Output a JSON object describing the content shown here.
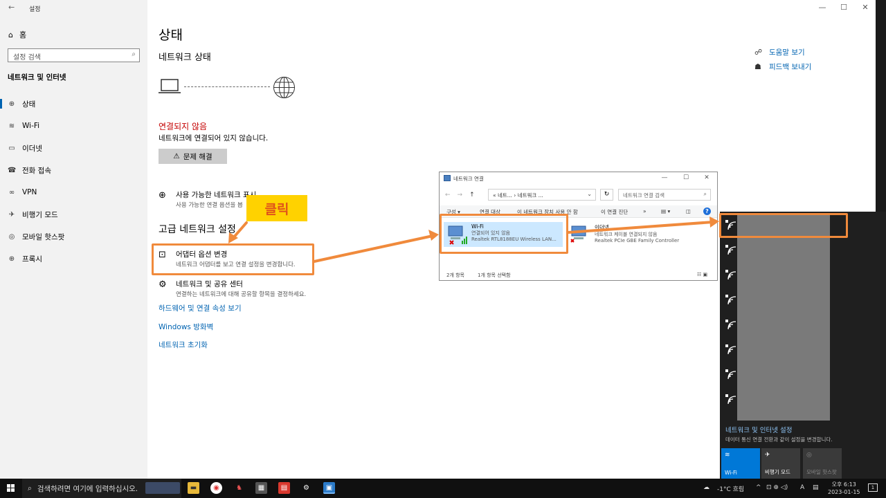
{
  "settings": {
    "window_title": "설정",
    "back_icon": "←",
    "min_icon": "—",
    "max_icon": "☐",
    "close_icon": "✕",
    "home_label": "홈",
    "search_placeholder": "설정 검색",
    "category_title": "네트워크 및 인터넷",
    "nav": [
      {
        "label": "상태",
        "icon": "status-icon"
      },
      {
        "label": "Wi-Fi",
        "icon": "wifi-icon"
      },
      {
        "label": "이더넷",
        "icon": "ethernet-icon"
      },
      {
        "label": "전화 접속",
        "icon": "dialup-icon"
      },
      {
        "label": "VPN",
        "icon": "vpn-icon"
      },
      {
        "label": "비행기 모드",
        "icon": "airplane-icon"
      },
      {
        "label": "모바일 핫스팟",
        "icon": "hotspot-icon"
      },
      {
        "label": "프록시",
        "icon": "proxy-icon"
      }
    ],
    "main": {
      "title": "상태",
      "subtitle": "네트워크 상태",
      "status": "연결되지 않음",
      "status_desc": "네트워크에 연결되어 있지 않습니다.",
      "troubleshoot_label": "문제 해결",
      "available_title": "사용 가능한 네트워크 표시",
      "available_desc": "사용 가능한 연결 옵션을 봅",
      "advanced_title": "고급 네트워크 설정",
      "adapter_title": "어댑터 옵션 변경",
      "adapter_desc": "네트워크 어댑터를 보고 연결 설정을 변경합니다.",
      "sharing_title": "네트워크 및 공유 센터",
      "sharing_desc": "연결하는 네트워크에 대해 공유할 항목을 결정하세요.",
      "links": [
        "하드웨어 및 연결 속성 보기",
        "Windows 방화벽",
        "네트워크 초기화"
      ]
    },
    "help_links": [
      "도움말 보기",
      "피드백 보내기"
    ]
  },
  "annotation": {
    "click_label": "클릭",
    "highlight_color": "#f08a3c",
    "label_bg": "#ffd200"
  },
  "netwin": {
    "title": "네트워크 연결",
    "address": "« 네트... › 네트워크 ...",
    "search_placeholder": "네트워크 연결 검색",
    "toolbar": [
      "구성 ▾",
      "연결 대상",
      "이 네트워크 장치 사용 안 함",
      "이 연결 진단",
      "»"
    ],
    "adapters": [
      {
        "name": "Wi-Fi",
        "status": "연결되어 있지 않음",
        "device": "Realtek RTL8188EU Wireless LAN..."
      },
      {
        "name": "이더넷",
        "status": "네트워크 케이블 연결되지 않음",
        "device": "Realtek PCIe GBE Family Controller"
      }
    ],
    "item_count": "2개 항목",
    "selected_count": "1개 항목 선택함"
  },
  "flyout": {
    "settings_link": "네트워크 및 인터넷 설정",
    "settings_desc": "데이터 통신 연결 전환과 같이 설정을 변경합니다.",
    "tiles": [
      {
        "label": "Wi-Fi",
        "icon": "wifi-icon",
        "active": true
      },
      {
        "label": "비행기 모드",
        "icon": "airplane-icon",
        "active": false
      },
      {
        "label": "모바일 핫스팟",
        "icon": "hotspot-icon",
        "active": false
      }
    ]
  },
  "taskbar": {
    "search_placeholder": "검색하려면 여기에 입력하십시오.",
    "weather": "-1°C 흐림",
    "ime": "A",
    "time": "오후 6:13",
    "date": "2023-01-15",
    "notification_count": "1"
  },
  "colors": {
    "accent": "#0063b1",
    "error": "#c40000",
    "flyout_link": "#8fc4f5"
  }
}
